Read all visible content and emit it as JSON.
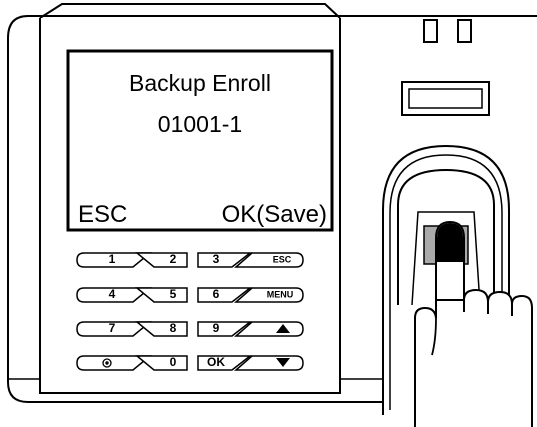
{
  "screen": {
    "title": "Backup Enroll",
    "user_id": "01001-1",
    "left_softkey": "ESC",
    "right_softkey": "OK(Save)"
  },
  "keypad": {
    "row1": [
      "1",
      "2",
      "3",
      "ESC"
    ],
    "row2": [
      "4",
      "5",
      "6",
      "MENU"
    ],
    "row3": [
      "7",
      "8",
      "9",
      "up-arrow-icon"
    ],
    "row4": [
      "power-dot-icon",
      "0",
      "OK",
      "down-arrow-icon"
    ]
  },
  "colors": {
    "outline": "#000000",
    "body": "#ffffff",
    "sensor_window": "#aaaaaa",
    "finger_tip": "#000000"
  }
}
